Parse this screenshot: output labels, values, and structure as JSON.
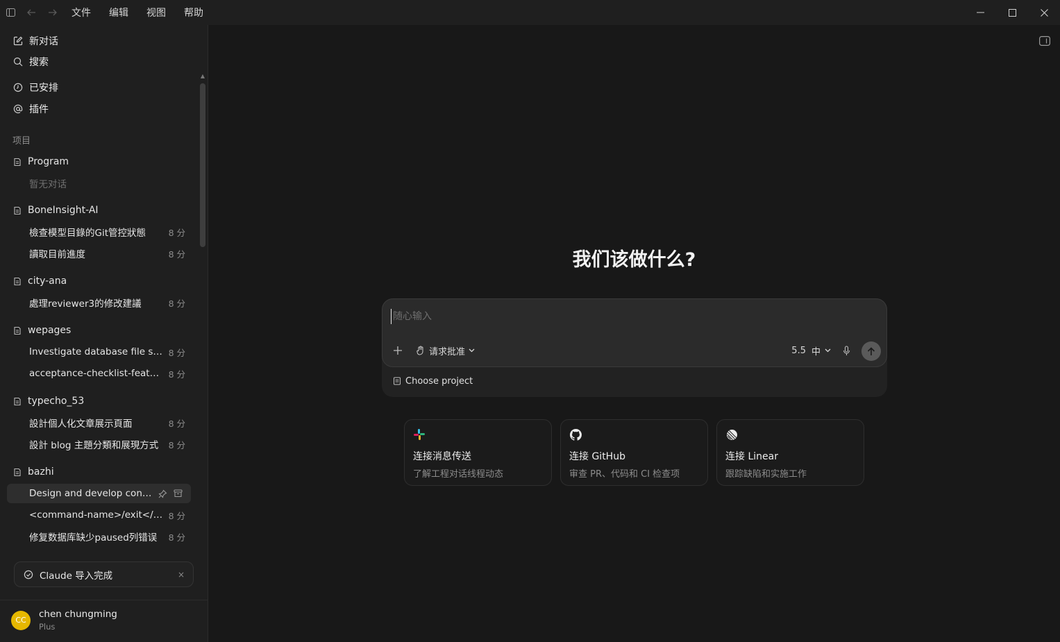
{
  "menu": {
    "items": [
      "文件",
      "编辑",
      "视图",
      "帮助"
    ]
  },
  "sidebar": {
    "nav": {
      "new_chat": "新对话",
      "search": "搜索",
      "scheduled": "已安排",
      "plugins": "插件"
    },
    "section_projects": "项目",
    "projects": [
      {
        "name": "Program",
        "empty": "暂无对话"
      },
      {
        "name": "BoneInsight-AI",
        "conversations": [
          {
            "title": "檢查模型目錄的Git管控狀態",
            "time": "8 分"
          },
          {
            "title": "讀取目前進度",
            "time": "8 分"
          }
        ]
      },
      {
        "name": "city-ana",
        "conversations": [
          {
            "title": "處理reviewer3的修改建議",
            "time": "8 分"
          }
        ]
      },
      {
        "name": "wepages",
        "conversations": [
          {
            "title": "Investigate database file size i...",
            "time": "8 分"
          },
          {
            "title": "acceptance-checklist-feature",
            "time": "8 分"
          }
        ]
      },
      {
        "name": "typecho_53",
        "conversations": [
          {
            "title": "設計個人化文章展示頁面",
            "time": "8 分"
          },
          {
            "title": "設計 blog 主題分類和展現方式",
            "time": "8 分"
          }
        ]
      },
      {
        "name": "bazhi",
        "conversations": [
          {
            "title": "Design and develop conve...",
            "time": ""
          },
          {
            "title": "<command-name>/exit</co...",
            "time": "8 分"
          },
          {
            "title": "修复数据库缺少paused列错误",
            "time": "8 分"
          }
        ]
      }
    ],
    "toast": {
      "text": "Claude 导入完成",
      "close": "×"
    },
    "user": {
      "initials": "CC",
      "name": "chen chungming",
      "plan": "Plus"
    }
  },
  "main": {
    "heading": "我们该做什么?",
    "composer": {
      "placeholder": "随心输入",
      "value": "",
      "approval_label": "请求批准",
      "model_label": "5.5",
      "effort_label": "中",
      "choose_project": "Choose project"
    },
    "cards": [
      {
        "title": "连接消息传送",
        "subtitle": "了解工程对话线程动态"
      },
      {
        "title": "连接 GitHub",
        "subtitle": "审查 PR、代码和 CI 检查项"
      },
      {
        "title": "连接 Linear",
        "subtitle": "跟踪缺陷和实施工作"
      }
    ]
  },
  "colors": {
    "avatar": "#e6b800",
    "send_button": "#5a5a5a"
  }
}
